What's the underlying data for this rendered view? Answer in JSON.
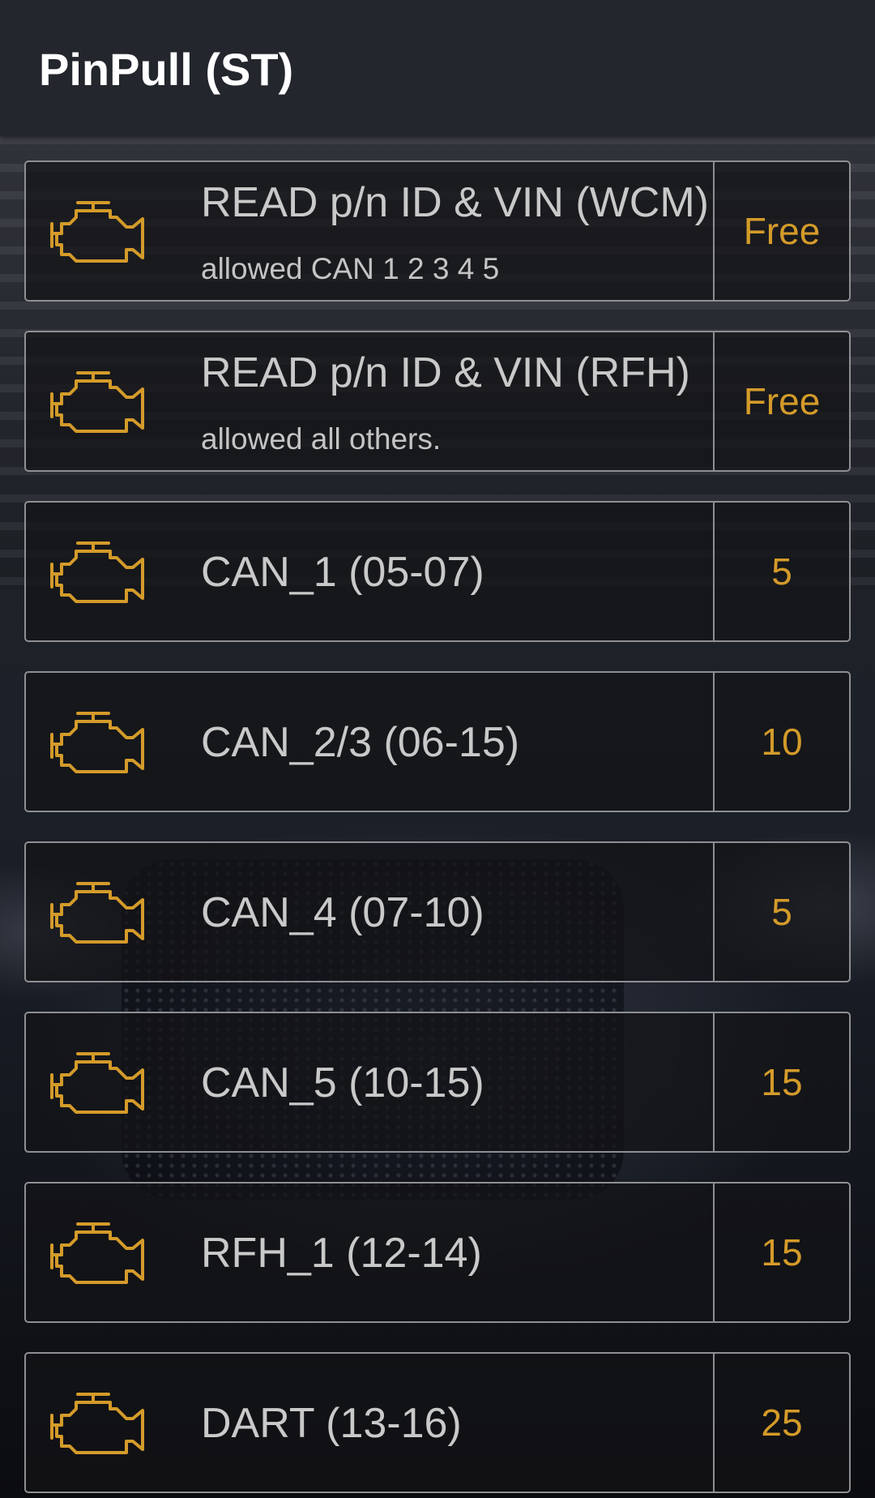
{
  "app": {
    "title": "PinPull (ST)"
  },
  "colors": {
    "accent": "#d49b2a",
    "header_bg": "#24262d",
    "text": "#c9c9c9"
  },
  "items": [
    {
      "icon": "engine-icon",
      "name": "READ p/n ID & VIN (WCM)",
      "subtitle": "allowed CAN 1 2 3 4 5",
      "price": "Free"
    },
    {
      "icon": "engine-icon",
      "name": "READ p/n ID & VIN (RFH)",
      "subtitle": "allowed all others.",
      "price": "Free"
    },
    {
      "icon": "engine-icon",
      "name": "CAN_1 (05-07)",
      "subtitle": "",
      "price": "5"
    },
    {
      "icon": "engine-icon",
      "name": "CAN_2/3 (06-15)",
      "subtitle": "",
      "price": "10"
    },
    {
      "icon": "engine-icon",
      "name": "CAN_4 (07-10)",
      "subtitle": "",
      "price": "5"
    },
    {
      "icon": "engine-icon",
      "name": "CAN_5 (10-15)",
      "subtitle": "",
      "price": "15"
    },
    {
      "icon": "engine-icon",
      "name": "RFH_1 (12-14)",
      "subtitle": "",
      "price": "15"
    },
    {
      "icon": "engine-icon",
      "name": "DART  (13-16)",
      "subtitle": "",
      "price": "25"
    }
  ]
}
